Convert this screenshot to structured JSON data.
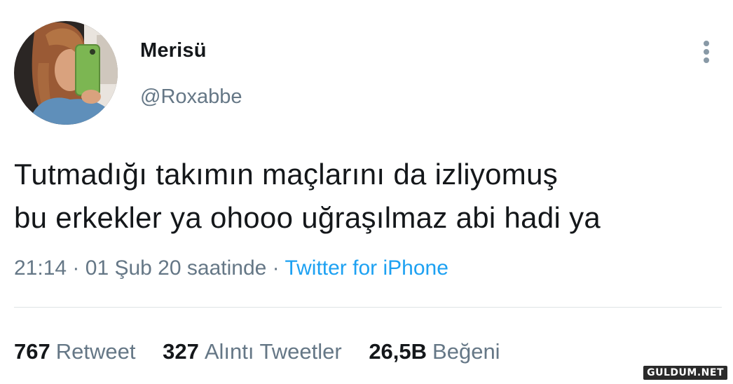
{
  "profile": {
    "display_name": "Merisü",
    "handle": "@Roxabbe",
    "more_icon": "more-vertical-icon"
  },
  "tweet": {
    "lines": [
      "Tutmadığı takımın maçlarını da izliyomuş",
      "bu erkekler ya ohooo uğraşılmaz abi hadi ya"
    ]
  },
  "meta": {
    "time": "21:14",
    "sep1": "·",
    "date": "01 Şub 20 saatinde",
    "sep2": "·",
    "source": "Twitter for iPhone"
  },
  "stats": {
    "retweets": {
      "count": "767",
      "label": "Retweet"
    },
    "quotes": {
      "count": "327",
      "label": "Alıntı Tweetler"
    },
    "likes": {
      "count": "26,5B",
      "label": "Beğeni"
    }
  },
  "watermark": "GULDUM.NET",
  "colors": {
    "primary_text": "#14171a",
    "secondary_text": "#657786",
    "link": "#1da1f2",
    "divider": "#dfe3e6"
  }
}
